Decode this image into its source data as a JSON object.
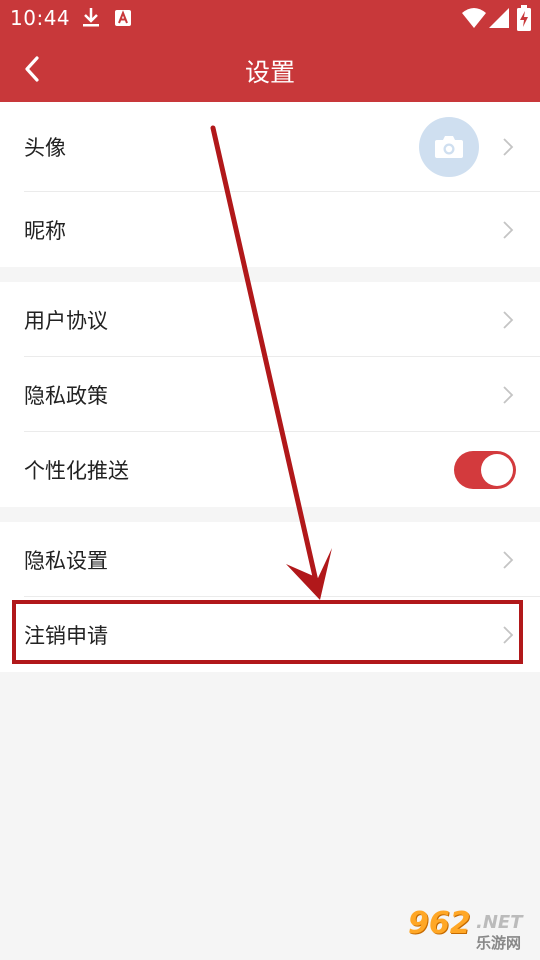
{
  "status_bar": {
    "time": "10:44"
  },
  "header": {
    "title": "设置"
  },
  "groups": {
    "profile": [
      {
        "label": "头像"
      },
      {
        "label": "昵称"
      }
    ],
    "policy": [
      {
        "label": "用户协议"
      },
      {
        "label": "隐私政策"
      },
      {
        "label": "个性化推送",
        "toggle_on": true
      }
    ],
    "account": [
      {
        "label": "隐私设置"
      },
      {
        "label": "注销申请"
      }
    ]
  },
  "colors": {
    "brand_red": "#c8383a",
    "toggle_on": "#d33a3d",
    "highlight": "#b1181a"
  },
  "watermark": {
    "number": "962",
    "net": ".NET",
    "site": "乐游网"
  }
}
